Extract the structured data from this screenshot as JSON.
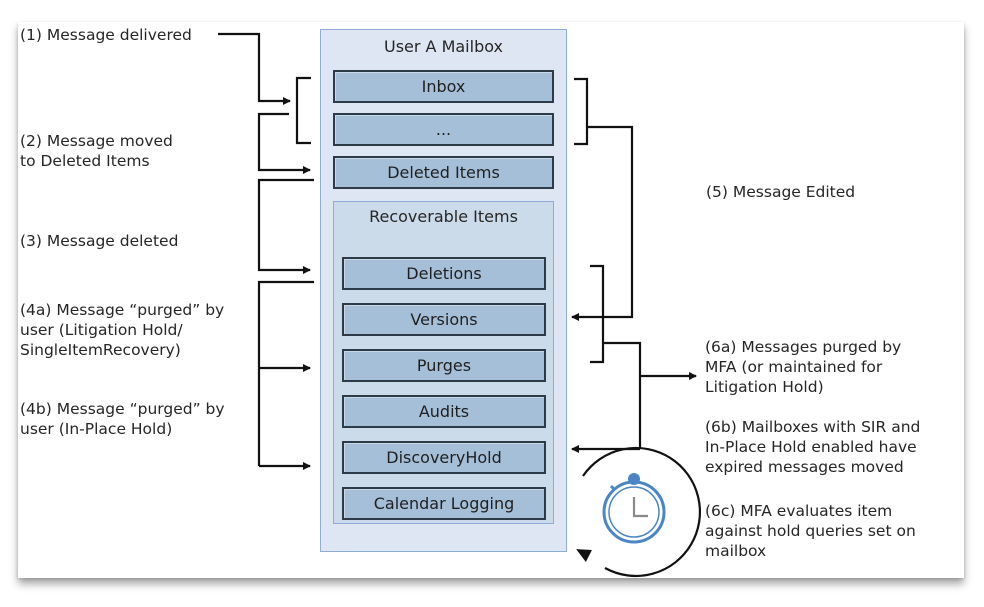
{
  "diagram": {
    "mailbox": {
      "title": "User A Mailbox",
      "folders": [
        "Inbox",
        "...",
        "Deleted Items"
      ],
      "recoverable_items": {
        "title": "Recoverable Items",
        "subfolders": [
          "Deletions",
          "Versions",
          "Purges",
          "Audits",
          "DiscoveryHold",
          "Calendar Logging"
        ]
      }
    },
    "steps": {
      "s1": "(1) Message delivered",
      "s2": "(2) Message moved\nto Deleted Items",
      "s3": "(3) Message deleted",
      "s4a": "(4a) Message “purged” by\nuser (Litigation Hold/\nSingleItemRecovery)",
      "s4b": "(4b) Message “purged” by\nuser (In-Place Hold)",
      "s5": "(5) Message Edited",
      "s6a": "(6a) Messages purged by\nMFA (or maintained for\nLitigation Hold)",
      "s6b": "(6b) Mailboxes with SIR and\nIn-Place Hold enabled have\nexpired messages moved",
      "s6c": "(6c) MFA evaluates item\nagainst hold queries set on\nmailbox"
    },
    "icons": {
      "timer": "stopwatch-icon",
      "cycle": "circular-arrow-icon"
    },
    "colors": {
      "mailbox_fill": "#dde6f2",
      "recoverable_fill": "#ccdbea",
      "folder_fill": "#a5bfd8",
      "border_blue": "#8fabd7",
      "stopwatch_blue": "#4a86c5"
    }
  }
}
